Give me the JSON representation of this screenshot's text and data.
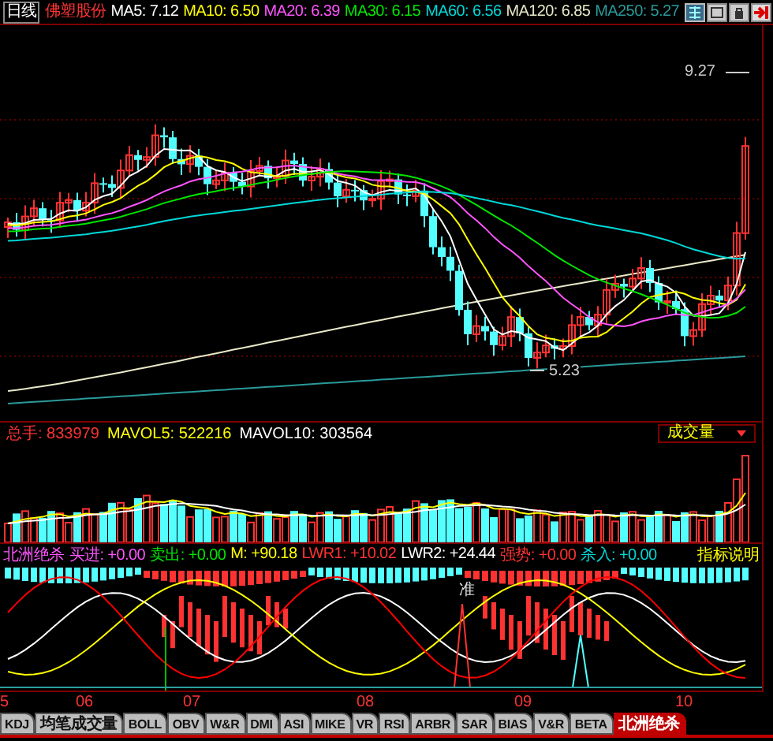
{
  "header": {
    "period": "日线",
    "stock_name": "佛塑股份",
    "ma": [
      {
        "label": "MA5: 7.12",
        "color": "#ffffff"
      },
      {
        "label": "MA10: 6.50",
        "color": "#ffff00"
      },
      {
        "label": "MA20: 6.39",
        "color": "#ff54ff"
      },
      {
        "label": "MA30: 6.15",
        "color": "#00e600"
      },
      {
        "label": "MA60: 6.56",
        "color": "#00d8d8"
      },
      {
        "label": "MA120: 6.85",
        "color": "#e8e8c8"
      },
      {
        "label": "MA250: 5.27",
        "color": "#2a9a9a"
      }
    ]
  },
  "price_labels": {
    "high": "9.27",
    "low": "5.23"
  },
  "volume": {
    "items": [
      {
        "label": "总手: 833979",
        "color": "#ff3232"
      },
      {
        "label": "MAVOL5: 522216",
        "color": "#ffff00"
      },
      {
        "label": "MAVOL10: 303564",
        "color": "#ffffff"
      }
    ],
    "selector": "成交量"
  },
  "indicator": {
    "name": "北洲绝杀",
    "items": [
      {
        "label": "买进: +0.00",
        "color": "#ff54ff"
      },
      {
        "label": "卖出: +0.00",
        "color": "#00e600"
      },
      {
        "label": "M: +90.18",
        "color": "#ffff00"
      },
      {
        "label": "LWR1: +10.02",
        "color": "#ff3232"
      },
      {
        "label": "LWR2: +24.44",
        "color": "#ffffff"
      },
      {
        "label": "强势: +0.00",
        "color": "#ff3232"
      },
      {
        "label": "杀入: +0.00",
        "color": "#00d8d8"
      }
    ],
    "help": "指标说明",
    "marker": "准"
  },
  "x_axis": [
    "5",
    "06",
    "07",
    "08",
    "09",
    "10"
  ],
  "tabs": [
    {
      "label": "KDJ",
      "selected": false
    },
    {
      "label": "均笔成交量",
      "selected": false
    },
    {
      "label": "BOLL",
      "selected": false
    },
    {
      "label": "OBV",
      "selected": false
    },
    {
      "label": "W&R",
      "selected": false
    },
    {
      "label": "DMI",
      "selected": false
    },
    {
      "label": "ASI",
      "selected": false
    },
    {
      "label": "MIKE",
      "selected": false
    },
    {
      "label": "VR",
      "selected": false
    },
    {
      "label": "RSI",
      "selected": false
    },
    {
      "label": "ARBR",
      "selected": false
    },
    {
      "label": "SAR",
      "selected": false
    },
    {
      "label": "BIAS",
      "selected": false
    },
    {
      "label": "V&R",
      "selected": false
    },
    {
      "label": "BETA",
      "selected": false
    },
    {
      "label": "北洲绝杀",
      "selected": true
    }
  ]
}
